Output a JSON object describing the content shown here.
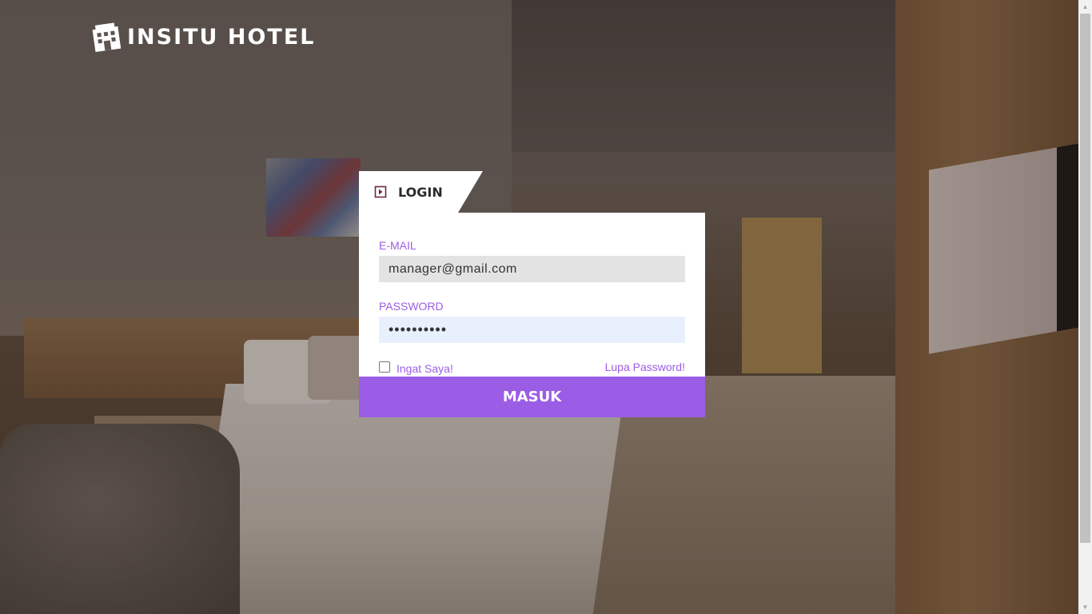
{
  "brand": {
    "logo_text": "INSITU HOTEL",
    "logo_icon": "hotel-building-icon"
  },
  "login": {
    "tab_label": "LOGIN",
    "tab_icon": "sign-in-arrow-icon",
    "email_label": "E-MAIL",
    "email_value": "manager@gmail.com",
    "password_label": "PASSWORD",
    "password_value": "••••••••••",
    "remember_label": "Ingat Saya!",
    "remember_checked": false,
    "forgot_label": "Lupa Password!",
    "submit_label": "MASUK"
  },
  "colors": {
    "accent": "#9b5de5",
    "card": "#ffffff",
    "email_field_bg": "#e4e3e3",
    "password_field_bg": "#e8f0fe"
  }
}
